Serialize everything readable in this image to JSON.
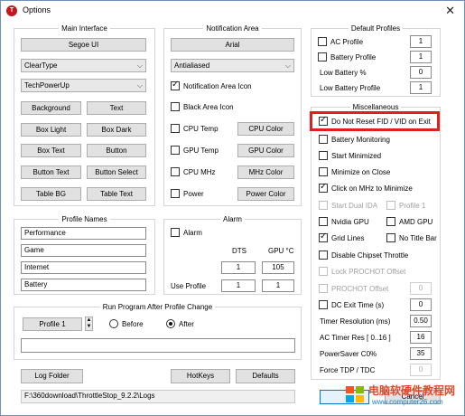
{
  "window": {
    "title": "Options",
    "app_icon": "T",
    "close": "✕"
  },
  "main_interface": {
    "title": "Main Interface",
    "font_button": "Segoe UI",
    "select1": "ClearType",
    "select2": "TechPowerUp",
    "buttons": [
      "Background",
      "Text",
      "Box Light",
      "Box Dark",
      "Box Text",
      "Button",
      "Button Text",
      "Button Select",
      "Table BG",
      "Table Text"
    ]
  },
  "notification_area": {
    "title": "Notification Area",
    "font_button": "Arial",
    "select": "Antialiased",
    "icon_checkbox": "Notification Area Icon",
    "black_icon": "Black Area Icon",
    "rows": [
      {
        "check": "CPU Temp",
        "button": "CPU Color"
      },
      {
        "check": "GPU Temp",
        "button": "GPU Color"
      },
      {
        "check": "CPU MHz",
        "button": "MHz Color"
      },
      {
        "check": "Power",
        "button": "Power Color"
      }
    ]
  },
  "profile_names": {
    "title": "Profile Names",
    "names": [
      "Performance",
      "Game",
      "Internet",
      "Battery"
    ]
  },
  "alarm": {
    "title": "Alarm",
    "checkbox": "Alarm",
    "dts_label": "DTS",
    "gpu_label": "GPU °C",
    "dts_value": "1",
    "gpu_value": "105",
    "use_profile_label": "Use Profile",
    "profile_dts": "1",
    "profile_gpu": "1"
  },
  "run_program": {
    "title": "Run Program After Profile Change",
    "profile_button": "Profile 1",
    "before": "Before",
    "after": "After",
    "path": ""
  },
  "bottom": {
    "log_folder": "Log Folder",
    "hotkeys": "HotKeys",
    "defaults": "Defaults",
    "log_path": "F:\\360download\\ThrottleStop_9.2.2\\Logs"
  },
  "default_profiles": {
    "title": "Default Profiles",
    "rows": [
      {
        "label": "AC Profile",
        "value": "1",
        "check": true
      },
      {
        "label": "Battery Profile",
        "value": "1",
        "check": true
      },
      {
        "label": "Low Battery %",
        "value": "0",
        "check": false
      },
      {
        "label": "Low Battery Profile",
        "value": "1",
        "check": false
      }
    ]
  },
  "misc": {
    "title": "Miscellaneous",
    "no_reset_fid": "Do Not Reset FID / VID on Exit",
    "battery_monitoring": "Battery Monitoring",
    "start_minimized": "Start Minimized",
    "minimize_on_close": "Minimize on Close",
    "click_mhz": "Click on MHz to Minimize",
    "start_dual_ida": "Start Dual IDA",
    "profile_1": "Profile 1",
    "nvidia_gpu": "Nvidia GPU",
    "amd_gpu": "AMD GPU",
    "grid_lines": "Grid Lines",
    "no_title_bar": "No Title Bar",
    "disable_chipset": "Disable Chipset Throttle",
    "lock_prochot": "Lock PROCHOT Offset",
    "prochot_offset": "PROCHOT Offset",
    "prochot_value": "0",
    "dc_exit": "DC Exit Time (s)",
    "dc_exit_value": "0",
    "timer_resolution": "Timer Resolution (ms)",
    "timer_resolution_value": "0.50",
    "ac_timer": "AC Timer Res [ 0..16 ]",
    "ac_timer_value": "16",
    "powersaver": "PowerSaver C0%",
    "powersaver_value": "35",
    "force_tdp": "Force TDP / TDC",
    "force_tdp_value": "0"
  },
  "cancel": "Cancel",
  "watermark": {
    "line1": "电脑软硬件教程网",
    "line2": "www.computer26.com"
  }
}
